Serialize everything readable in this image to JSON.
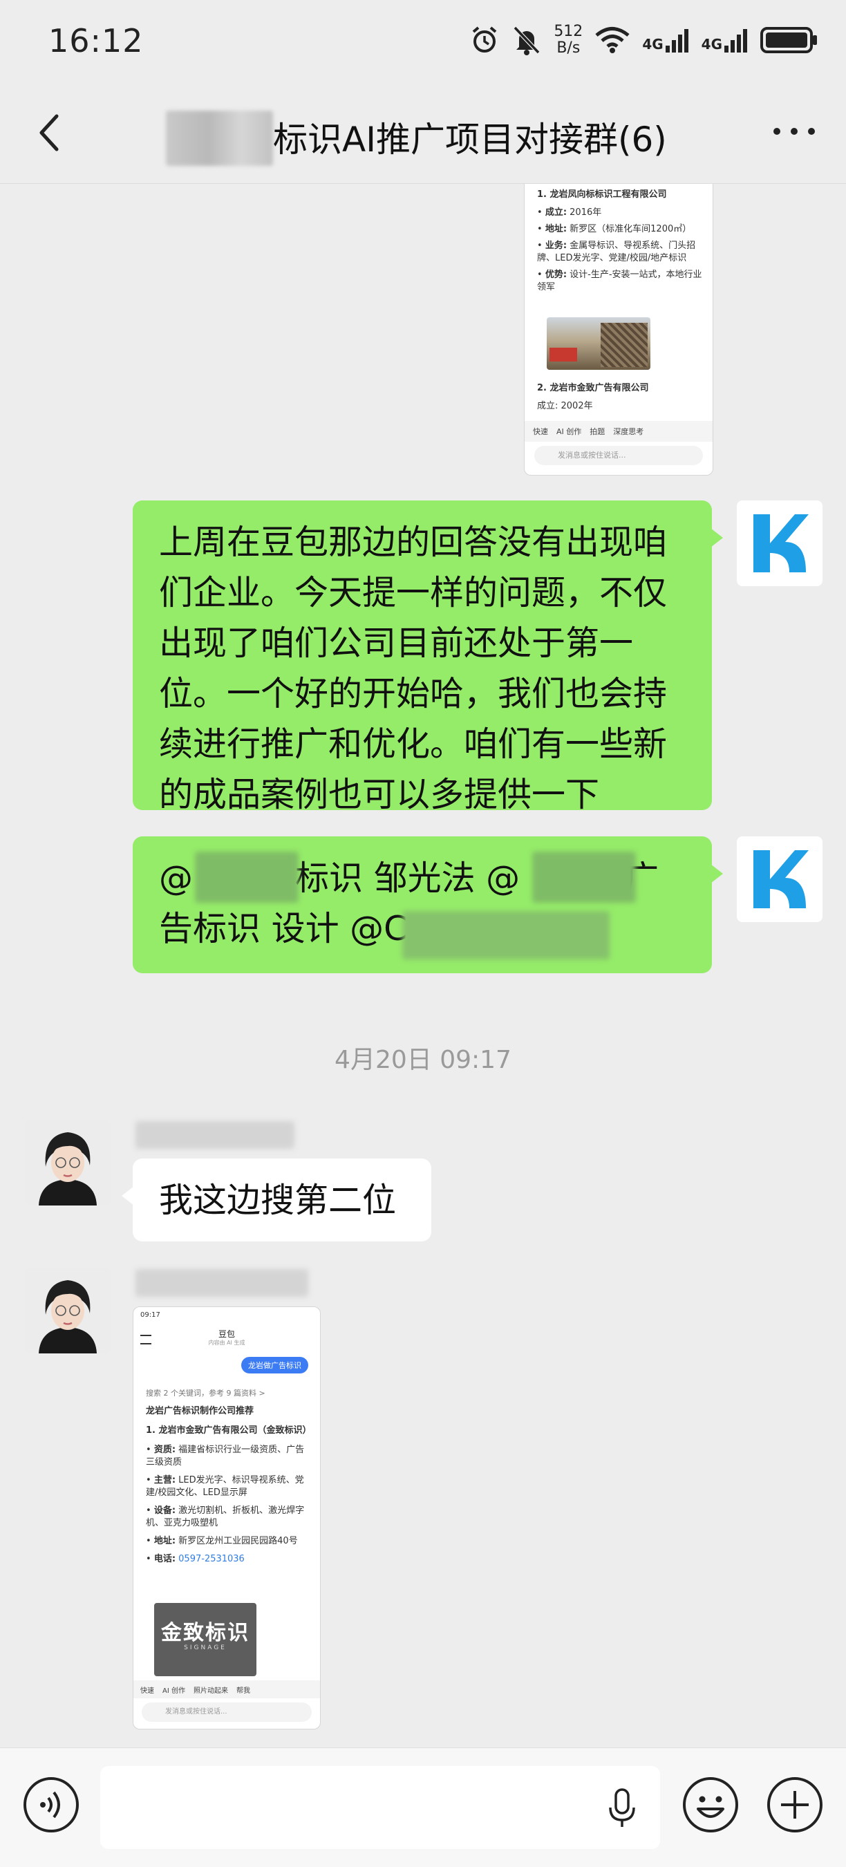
{
  "status_bar": {
    "time": "16:12",
    "net_speed_top": "512",
    "net_speed_bottom": "B/s",
    "signal1_label": "4G",
    "signal2_label": "4G",
    "icons": [
      "alarm-icon",
      "mute-icon",
      "wifi-icon",
      "signal-icon",
      "signal-icon",
      "battery-icon"
    ]
  },
  "header": {
    "title": "标识AI推广项目对接群(6)",
    "back_icon": "chevron-left-icon",
    "more_icon": "more-horizontal-icon"
  },
  "shared_screenshot_1": {
    "company_heading": "1. 龙岩凤向标标识工程有限公司",
    "items": [
      {
        "key": "成立:",
        "value": "2016年"
      },
      {
        "key": "地址:",
        "value": "新罗区（标准化车间1200㎡）"
      },
      {
        "key": "业务:",
        "value": "金属导标识、导视系统、门头招牌、LED发光字、党建/校园/地产标识"
      },
      {
        "key": "优势:",
        "value": "设计-生产-安装一站式，本地行业领军"
      }
    ],
    "company2_heading": "2. 龙岩市金致广告有限公司",
    "company2_line": "成立: 2002年",
    "toolbar": [
      "快速",
      "AI 创作",
      "拍题",
      "深度思考"
    ],
    "input_placeholder": "发消息或按住说话..."
  },
  "messages": [
    {
      "text": "上周在豆包那边的回答没有出现咱们企业。今天提一样的问题，不仅出现了咱们公司目前还处于第一位。一个好的开始哈，我们也会持续进行推广和优化。咱们有一些新的成品案例也可以多提供一下"
    },
    {
      "part1": "@",
      "part2": "标识  邹光法  @",
      "part3": "广告标识 设计  @C"
    }
  ],
  "timestamp": "4月20日 09:17",
  "incoming": {
    "text": "我这边搜第二位"
  },
  "shared_screenshot_2": {
    "status_time": "09:17",
    "app_title": "豆包",
    "app_subtitle": "内容由 AI 生成",
    "user_query": "龙岩做广告标识",
    "search_note": "搜索 2 个关键词，参考 9 篇资料 >",
    "heading": "龙岩广告标识制作公司推荐",
    "company": "1. 龙岩市金致广告有限公司（金致标识）",
    "items": [
      {
        "key": "资质:",
        "value": "福建省标识行业一级资质、广告三级资质"
      },
      {
        "key": "主营:",
        "value": "LED发光字、标识导视系统、党建/校园文化、LED显示屏"
      },
      {
        "key": "设备:",
        "value": "激光切割机、折板机、激光焊字机、亚克力吸塑机"
      },
      {
        "key": "地址:",
        "value": "新罗区龙州工业园民园路40号"
      },
      {
        "key": "电话:",
        "value": "0597-2531036"
      }
    ],
    "logo_text": "金致标识",
    "logo_sub": "SIGNAGE",
    "toolbar": [
      "快速",
      "AI 创作",
      "照片动起来",
      "帮我"
    ],
    "input_placeholder": "发消息或按住说话..."
  },
  "input_bar": {
    "voice_icon": "voice-icon",
    "mic_icon": "microphone-icon",
    "emoji_icon": "emoji-icon",
    "plus_icon": "plus-circle-icon"
  },
  "colors": {
    "background": "#ededed",
    "outgoing_bubble": "#95ec69",
    "incoming_bubble": "#ffffff",
    "avatar_k": "#1fa0e6"
  }
}
